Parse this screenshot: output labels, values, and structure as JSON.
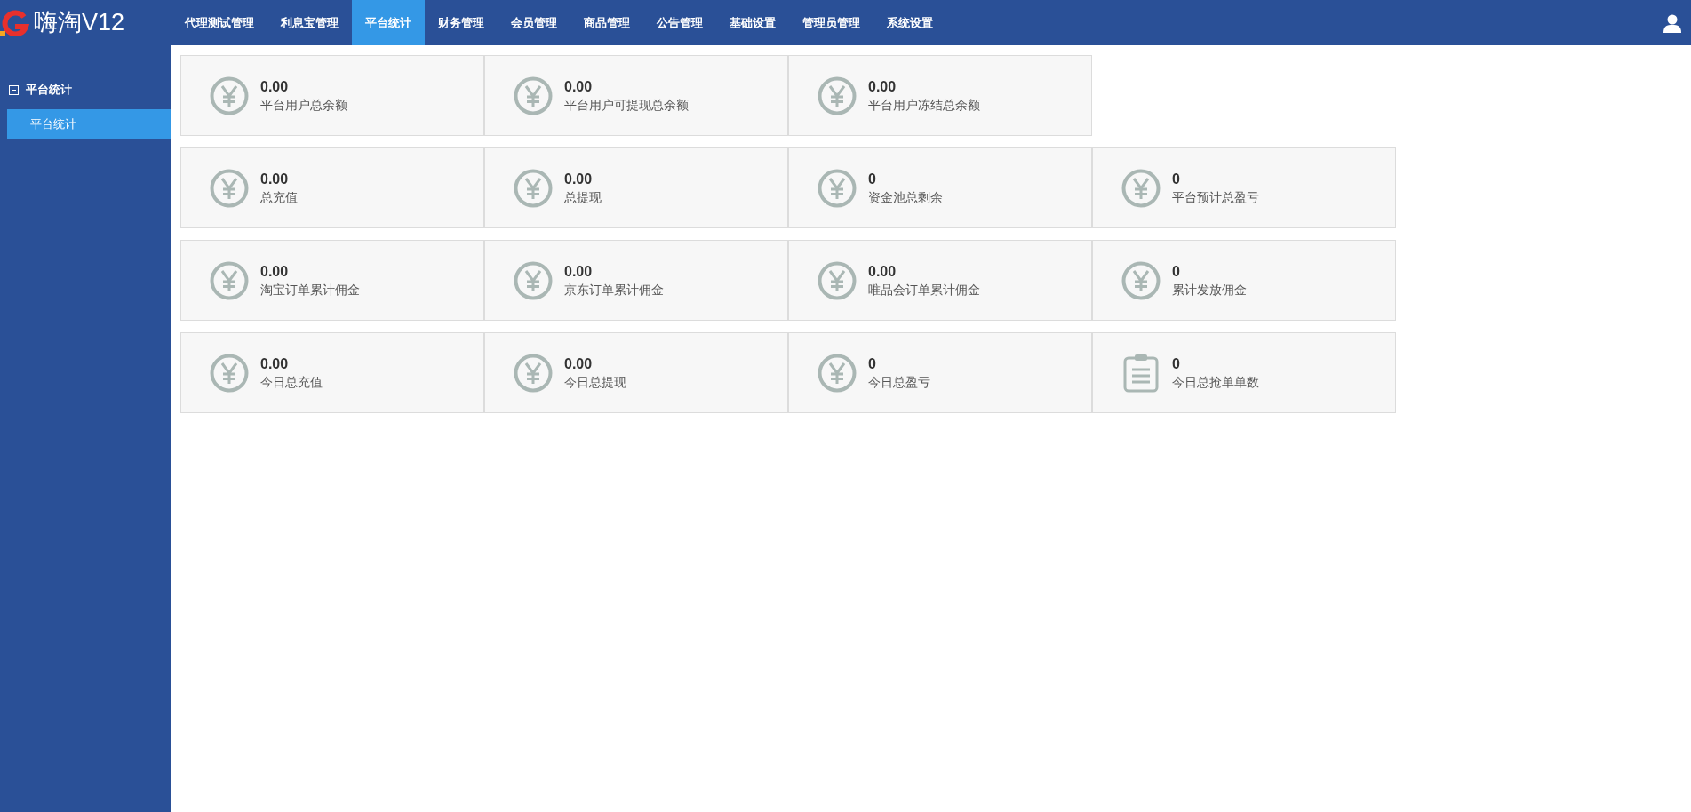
{
  "header": {
    "brand": "嗨淘V12",
    "nav": [
      {
        "label": "代理测试管理",
        "selected": false
      },
      {
        "label": "利息宝管理",
        "selected": false
      },
      {
        "label": "平台统计",
        "selected": true
      },
      {
        "label": "财务管理",
        "selected": false
      },
      {
        "label": "会员管理",
        "selected": false
      },
      {
        "label": "商品管理",
        "selected": false
      },
      {
        "label": "公告管理",
        "selected": false
      },
      {
        "label": "基础设置",
        "selected": false
      },
      {
        "label": "管理员管理",
        "selected": false
      },
      {
        "label": "系统设置",
        "selected": false
      }
    ]
  },
  "sidebar": {
    "groups": [
      {
        "label": "平台统计",
        "expanded": true,
        "children": [
          {
            "label": "平台统计",
            "selected": true
          }
        ]
      }
    ]
  },
  "stat_rows": [
    [
      {
        "kind": "yen",
        "value": "0.00",
        "label": "平台用户总余额"
      },
      {
        "kind": "yen",
        "value": "0.00",
        "label": "平台用户可提现总余额"
      },
      {
        "kind": "yen",
        "value": "0.00",
        "label": "平台用户冻结总余额"
      }
    ],
    [
      {
        "kind": "yen",
        "value": "0.00",
        "label": "总充值"
      },
      {
        "kind": "yen",
        "value": "0.00",
        "label": "总提现"
      },
      {
        "kind": "yen",
        "value": "0",
        "label": "资金池总剩余"
      },
      {
        "kind": "yen",
        "value": "0",
        "label": "平台预计总盈亏"
      }
    ],
    [
      {
        "kind": "yen",
        "value": "0.00",
        "label": "淘宝订单累计佣金"
      },
      {
        "kind": "yen",
        "value": "0.00",
        "label": "京东订单累计佣金"
      },
      {
        "kind": "yen",
        "value": "0.00",
        "label": "唯品会订单累计佣金"
      },
      {
        "kind": "yen",
        "value": "0",
        "label": "累计发放佣金"
      }
    ],
    [
      {
        "kind": "yen",
        "value": "0.00",
        "label": "今日总充值"
      },
      {
        "kind": "yen",
        "value": "0.00",
        "label": "今日总提现"
      },
      {
        "kind": "yen",
        "value": "0",
        "label": "今日总盈亏"
      },
      {
        "kind": "clipboard",
        "value": "0",
        "label": "今日总抢单单数"
      }
    ]
  ]
}
